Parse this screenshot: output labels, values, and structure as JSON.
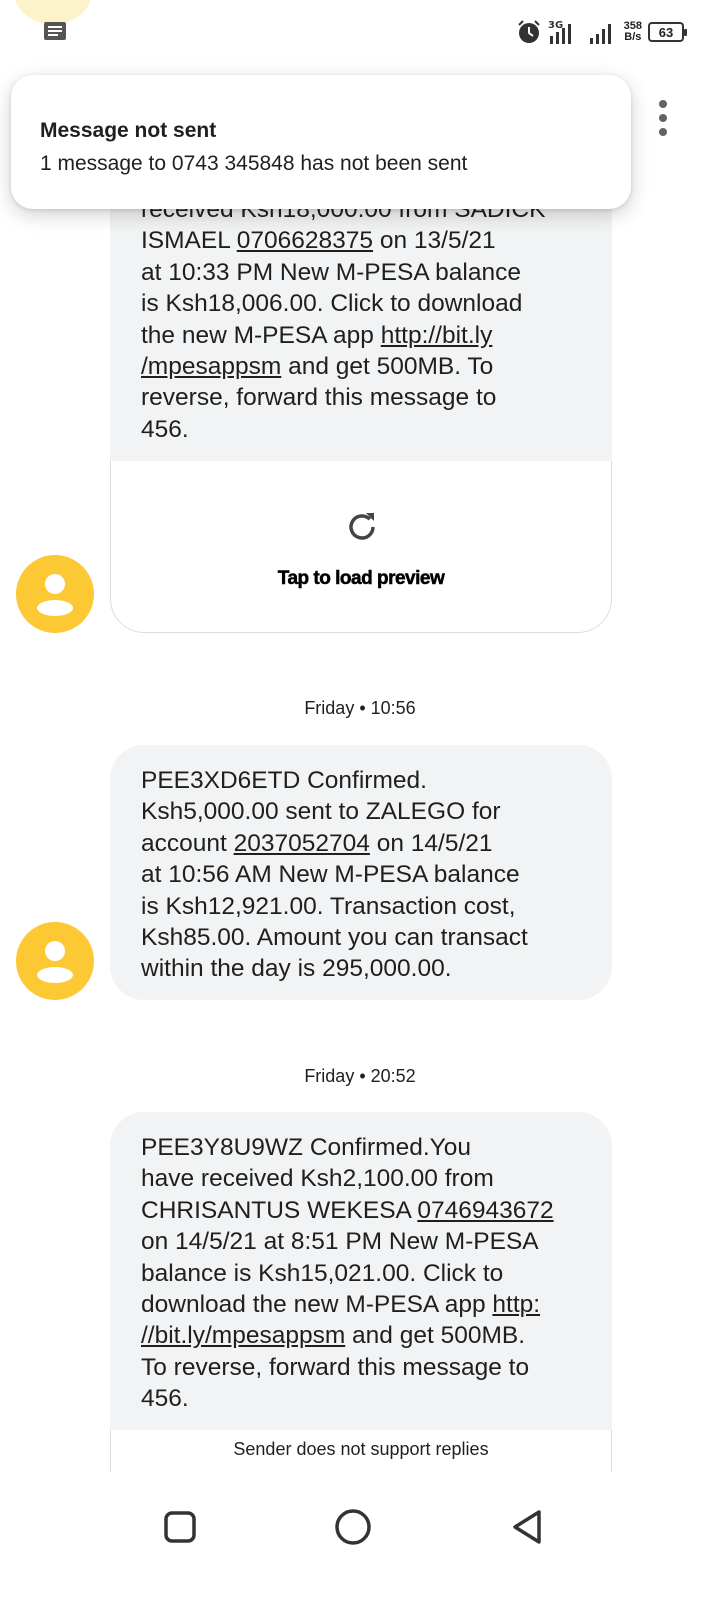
{
  "status_bar": {
    "network_type": "3G",
    "speed_value": "358",
    "speed_unit": "B/s",
    "battery": "63"
  },
  "toast": {
    "title": "Message not sent",
    "body": "1 message to 0743 345848 has not been sent"
  },
  "messages": [
    {
      "lines": [
        "received Ksh18,000.00 from SADICK",
        "ISMAEL ",
        "0706628375",
        " on 13/5/21",
        "at 10:33 PM  New M-PESA balance",
        "is Ksh18,006.00. Click to download",
        "the new M-PESA app ",
        "http://bit.ly",
        "/mpesappsm",
        " and get 500MB. To",
        "reverse, forward this message to",
        "456."
      ],
      "preview_label": "Tap to load preview"
    },
    {
      "timestamp": "Friday • 10:56",
      "lines": [
        "PEE3XD6ETD Confirmed.",
        "Ksh5,000.00 sent to ZALEGO  for",
        "account ",
        "2037052704",
        " on 14/5/21",
        "at 10:56 AM New M-PESA balance",
        "is Ksh12,921.00. Transaction cost,",
        "Ksh85.00. Amount you can transact",
        "within the day is 295,000.00."
      ]
    },
    {
      "timestamp": "Friday • 20:52",
      "lines": [
        "PEE3Y8U9WZ Confirmed.You",
        "have received Ksh2,100.00 from",
        "CHRISANTUS  WEKESA ",
        "0746943672",
        "on 14/5/21 at 8:51 PM  New M-PESA",
        "balance is Ksh15,021.00. Click to",
        "download the new M-PESA app ",
        "http:",
        "//bit.ly/mpesappsm",
        " and get 500MB.",
        "To reverse, forward this message to",
        "456."
      ],
      "footer": "Sender does not support replies"
    }
  ],
  "colors": {
    "bubble": "#f1f3f4",
    "avatar": "#fcc934",
    "text": "#1f1f1f"
  },
  "icons": {
    "notification": "message-notification-icon",
    "alarm": "alarm-clock-icon",
    "refresh": "refresh-icon",
    "overflow": "more-vert-icon",
    "avatar": "person-icon",
    "nav_recents": "square-icon",
    "nav_home": "circle-icon",
    "nav_back": "triangle-back-icon"
  }
}
